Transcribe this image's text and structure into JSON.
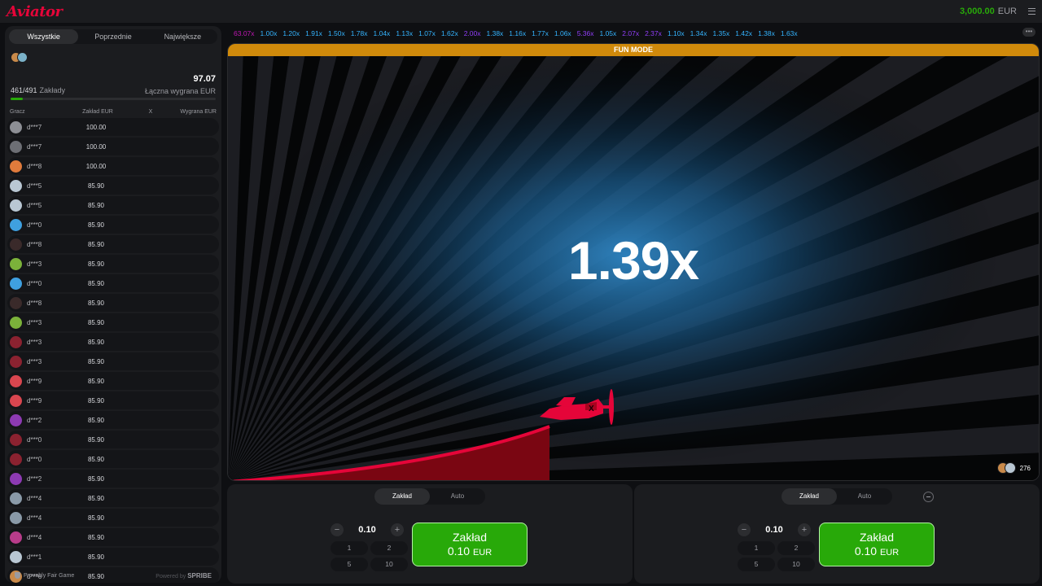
{
  "header": {
    "logo": "Aviator",
    "balance": "3,000.00",
    "currency": "EUR"
  },
  "left": {
    "tabs": [
      "Wszystkie",
      "Poprzednie",
      "Największe"
    ],
    "bets_count": "461/491",
    "bets_label": "Zakłady",
    "total_win": "97.07",
    "total_win_label": "Łączna wygrana EUR",
    "bets_progress_percent": 6,
    "columns": {
      "player": "Gracz",
      "bet": "Zakład EUR",
      "x": "X",
      "win": "Wygrana EUR"
    },
    "rows": [
      {
        "name": "d***7",
        "bet": "100.00",
        "color": "#8d8f95"
      },
      {
        "name": "d***7",
        "bet": "100.00",
        "color": "#6d6f75"
      },
      {
        "name": "d***8",
        "bet": "100.00",
        "color": "#e07b3c"
      },
      {
        "name": "d***5",
        "bet": "85.90",
        "color": "#b9c7d3"
      },
      {
        "name": "d***5",
        "bet": "85.90",
        "color": "#b9c7d3"
      },
      {
        "name": "d***0",
        "bet": "85.90",
        "color": "#3fa0e0"
      },
      {
        "name": "d***8",
        "bet": "85.90",
        "color": "#3a2a2a"
      },
      {
        "name": "d***3",
        "bet": "85.90",
        "color": "#7bb23a"
      },
      {
        "name": "d***0",
        "bet": "85.90",
        "color": "#3fa0e0"
      },
      {
        "name": "d***8",
        "bet": "85.90",
        "color": "#3a2a2a"
      },
      {
        "name": "d***3",
        "bet": "85.90",
        "color": "#7bb23a"
      },
      {
        "name": "d***3",
        "bet": "85.90",
        "color": "#8b2230"
      },
      {
        "name": "d***3",
        "bet": "85.90",
        "color": "#8b2230"
      },
      {
        "name": "d***9",
        "bet": "85.90",
        "color": "#d9464f"
      },
      {
        "name": "d***9",
        "bet": "85.90",
        "color": "#d9464f"
      },
      {
        "name": "d***2",
        "bet": "85.90",
        "color": "#8d3ab3"
      },
      {
        "name": "d***0",
        "bet": "85.90",
        "color": "#8b2230"
      },
      {
        "name": "d***0",
        "bet": "85.90",
        "color": "#8b2230"
      },
      {
        "name": "d***2",
        "bet": "85.90",
        "color": "#8d3ab3"
      },
      {
        "name": "d***4",
        "bet": "85.90",
        "color": "#8a9aa8"
      },
      {
        "name": "d***4",
        "bet": "85.90",
        "color": "#8a9aa8"
      },
      {
        "name": "d***4",
        "bet": "85.90",
        "color": "#b83c8a"
      },
      {
        "name": "d***1",
        "bet": "85.90",
        "color": "#b9c7d3"
      },
      {
        "name": "d***6",
        "bet": "85.90",
        "color": "#c98a4a"
      }
    ],
    "footer_fair": "Provably Fair Game",
    "footer_powered": "Powered by",
    "footer_brand": "SPRIBE"
  },
  "history": [
    {
      "v": "63.07x",
      "c": "#c017b4"
    },
    {
      "v": "1.00x",
      "c": "#34b4ff"
    },
    {
      "v": "1.20x",
      "c": "#34b4ff"
    },
    {
      "v": "1.91x",
      "c": "#34b4ff"
    },
    {
      "v": "1.50x",
      "c": "#34b4ff"
    },
    {
      "v": "1.78x",
      "c": "#34b4ff"
    },
    {
      "v": "1.04x",
      "c": "#34b4ff"
    },
    {
      "v": "1.13x",
      "c": "#34b4ff"
    },
    {
      "v": "1.07x",
      "c": "#34b4ff"
    },
    {
      "v": "1.62x",
      "c": "#34b4ff"
    },
    {
      "v": "2.00x",
      "c": "#913ef8"
    },
    {
      "v": "1.38x",
      "c": "#34b4ff"
    },
    {
      "v": "1.16x",
      "c": "#34b4ff"
    },
    {
      "v": "1.77x",
      "c": "#34b4ff"
    },
    {
      "v": "1.06x",
      "c": "#34b4ff"
    },
    {
      "v": "5.36x",
      "c": "#913ef8"
    },
    {
      "v": "1.05x",
      "c": "#34b4ff"
    },
    {
      "v": "2.07x",
      "c": "#913ef8"
    },
    {
      "v": "2.37x",
      "c": "#913ef8"
    },
    {
      "v": "1.10x",
      "c": "#34b4ff"
    },
    {
      "v": "1.34x",
      "c": "#34b4ff"
    },
    {
      "v": "1.35x",
      "c": "#34b4ff"
    },
    {
      "v": "1.42x",
      "c": "#34b4ff"
    },
    {
      "v": "1.38x",
      "c": "#34b4ff"
    },
    {
      "v": "1.63x",
      "c": "#34b4ff"
    }
  ],
  "game": {
    "mode": "FUN MODE",
    "multiplier": "1.39x",
    "online": "276"
  },
  "bet_panels": [
    {
      "tabs": [
        "Zakład",
        "Auto"
      ],
      "amount": "0.10",
      "quick": [
        "1",
        "2",
        "5",
        "10"
      ],
      "button_label": "Zakład",
      "button_amount": "0.10",
      "button_currency": "EUR"
    },
    {
      "tabs": [
        "Zakład",
        "Auto"
      ],
      "amount": "0.10",
      "quick": [
        "1",
        "2",
        "5",
        "10"
      ],
      "button_label": "Zakład",
      "button_amount": "0.10",
      "button_currency": "EUR"
    }
  ],
  "colors": {
    "accent_red": "#e50539",
    "green": "#28a909",
    "funmode": "#d08a0b"
  }
}
